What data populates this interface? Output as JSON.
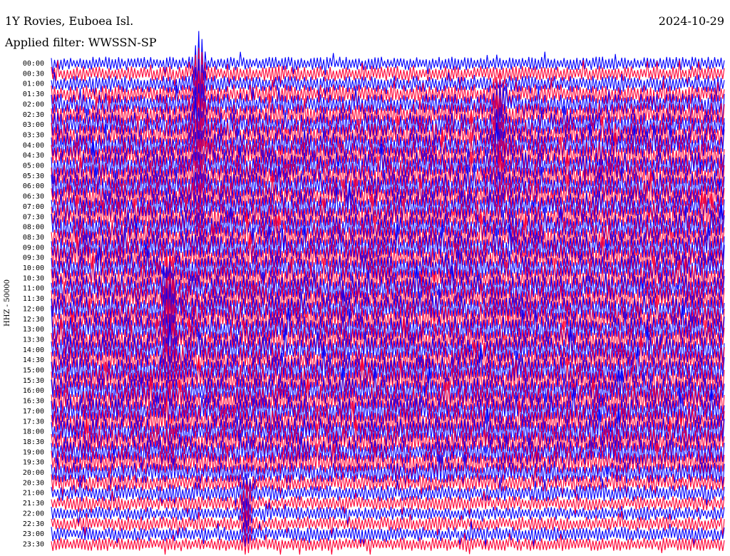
{
  "header": {
    "station": "1Y Rovies, Euboea Isl.",
    "date": "2024-10-29",
    "filter": "Applied filter: WWSSN-SP"
  },
  "axis": {
    "channel_label": "HHZ - 50000"
  },
  "colors": {
    "trace_a": "#0000ff",
    "trace_b": "#ff0033",
    "background": "#ffffff"
  },
  "chart_data": {
    "type": "line",
    "ylabel": "HHZ - 50000",
    "grid": false,
    "legend": "none",
    "rows": [
      {
        "label": "00:00",
        "color": "#0000ff",
        "level": 0.35
      },
      {
        "label": "00:30",
        "color": "#ff0033",
        "level": 0.45
      },
      {
        "label": "01:00",
        "color": "#0000ff",
        "level": 0.5
      },
      {
        "label": "01:30",
        "color": "#ff0033",
        "level": 0.65
      },
      {
        "label": "02:00",
        "color": "#0000ff",
        "level": 0.75
      },
      {
        "label": "02:30",
        "color": "#ff0033",
        "level": 0.85
      },
      {
        "label": "03:00",
        "color": "#0000ff",
        "level": 0.9
      },
      {
        "label": "03:30",
        "color": "#ff0033",
        "level": 0.95
      },
      {
        "label": "04:00",
        "color": "#0000ff",
        "level": 0.95
      },
      {
        "label": "04:30",
        "color": "#ff0033",
        "level": 1.0
      },
      {
        "label": "05:00",
        "color": "#0000ff",
        "level": 1.0
      },
      {
        "label": "05:30",
        "color": "#ff0033",
        "level": 1.0
      },
      {
        "label": "06:00",
        "color": "#0000ff",
        "level": 1.0
      },
      {
        "label": "06:30",
        "color": "#ff0033",
        "level": 1.0
      },
      {
        "label": "07:00",
        "color": "#0000ff",
        "level": 1.0
      },
      {
        "label": "07:30",
        "color": "#ff0033",
        "level": 1.0
      },
      {
        "label": "08:00",
        "color": "#0000ff",
        "level": 1.0
      },
      {
        "label": "08:30",
        "color": "#ff0033",
        "level": 1.0
      },
      {
        "label": "09:00",
        "color": "#0000ff",
        "level": 1.0
      },
      {
        "label": "09:30",
        "color": "#ff0033",
        "level": 1.0
      },
      {
        "label": "10:00",
        "color": "#0000ff",
        "level": 1.0
      },
      {
        "label": "10:30",
        "color": "#ff0033",
        "level": 1.0
      },
      {
        "label": "11:00",
        "color": "#0000ff",
        "level": 1.0
      },
      {
        "label": "11:30",
        "color": "#ff0033",
        "level": 1.0
      },
      {
        "label": "12:00",
        "color": "#0000ff",
        "level": 1.0
      },
      {
        "label": "12:30",
        "color": "#ff0033",
        "level": 1.0
      },
      {
        "label": "13:00",
        "color": "#0000ff",
        "level": 1.0
      },
      {
        "label": "13:30",
        "color": "#ff0033",
        "level": 1.0
      },
      {
        "label": "14:00",
        "color": "#0000ff",
        "level": 1.0
      },
      {
        "label": "14:30",
        "color": "#ff0033",
        "level": 1.0
      },
      {
        "label": "15:00",
        "color": "#0000ff",
        "level": 1.0
      },
      {
        "label": "15:30",
        "color": "#ff0033",
        "level": 1.0
      },
      {
        "label": "16:00",
        "color": "#0000ff",
        "level": 1.0
      },
      {
        "label": "16:30",
        "color": "#ff0033",
        "level": 1.0
      },
      {
        "label": "17:00",
        "color": "#0000ff",
        "level": 1.0
      },
      {
        "label": "17:30",
        "color": "#ff0033",
        "level": 1.0
      },
      {
        "label": "18:00",
        "color": "#0000ff",
        "level": 1.0
      },
      {
        "label": "18:30",
        "color": "#ff0033",
        "level": 0.95
      },
      {
        "label": "19:00",
        "color": "#0000ff",
        "level": 0.9
      },
      {
        "label": "19:30",
        "color": "#ff0033",
        "level": 0.85
      },
      {
        "label": "20:00",
        "color": "#0000ff",
        "level": 0.7
      },
      {
        "label": "20:30",
        "color": "#ff0033",
        "level": 0.55
      },
      {
        "label": "21:00",
        "color": "#0000ff",
        "level": 0.5
      },
      {
        "label": "21:30",
        "color": "#ff0033",
        "level": 0.4
      },
      {
        "label": "22:00",
        "color": "#0000ff",
        "level": 0.35
      },
      {
        "label": "22:30",
        "color": "#ff0033",
        "level": 0.4
      },
      {
        "label": "23:00",
        "color": "#0000ff",
        "level": 0.4
      },
      {
        "label": "23:30",
        "color": "#ff0033",
        "level": 0.35
      }
    ],
    "events": [
      {
        "time": "00:00",
        "x_fraction": 0.22,
        "strength": 1.0
      },
      {
        "time": "01:30",
        "x_fraction": 0.665,
        "strength": 0.6
      },
      {
        "time": "10:30",
        "x_fraction": 0.175,
        "strength": 0.7
      },
      {
        "time": "21:00",
        "x_fraction": 0.29,
        "strength": 0.5
      }
    ]
  }
}
